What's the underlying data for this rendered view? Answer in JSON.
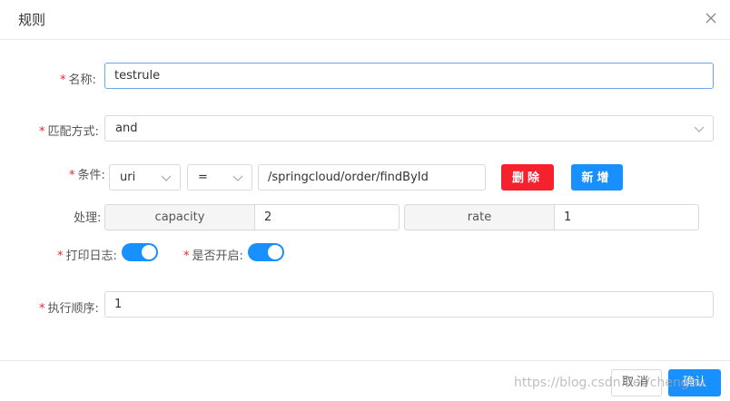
{
  "modal": {
    "title": "规则",
    "close_icon": "close-icon"
  },
  "form": {
    "name": {
      "label": "名称:",
      "value": "testrule"
    },
    "match_mode": {
      "label": "匹配方式:",
      "value": "and"
    },
    "condition": {
      "label": "条件:",
      "param_type": "uri",
      "operator": "=",
      "value": "/springcloud/order/findById",
      "delete_label": "删除",
      "add_label": "新增"
    },
    "handle": {
      "label": "处理:",
      "fields": [
        {
          "key": "capacity",
          "value": "2"
        },
        {
          "key": "rate",
          "value": "1"
        }
      ]
    },
    "log": {
      "label": "打印日志:",
      "on": true
    },
    "enabled": {
      "label": "是否开启:",
      "on": true
    },
    "order": {
      "label": "执行顺序:",
      "value": "1"
    }
  },
  "footer": {
    "cancel_label": "取消",
    "ok_label": "确认"
  },
  "watermark": "https://blog.csdn.net/chengbu",
  "colors": {
    "primary": "#1890ff",
    "danger": "#f5222d",
    "required": "#f5222d"
  }
}
